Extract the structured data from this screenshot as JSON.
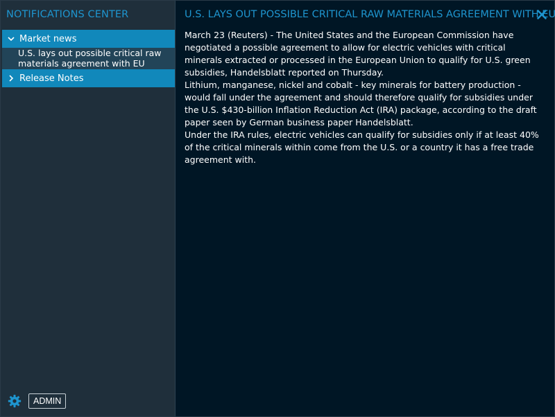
{
  "sidebar": {
    "title": "NOTIFICATIONS CENTER",
    "groups": [
      {
        "label": "Market news",
        "icon": "chevron-down-icon",
        "expanded": true,
        "items": [
          {
            "label": "U.S. lays out possible critical raw materials agreement with EU"
          }
        ]
      },
      {
        "label": "Release Notes",
        "icon": "chevron-right-icon",
        "expanded": false,
        "items": []
      }
    ],
    "footer": {
      "settings_icon": "gear-icon",
      "admin_label": "ADMIN"
    }
  },
  "article": {
    "title": "U.S. LAYS OUT POSSIBLE CRITICAL RAW MATERIALS AGREEMENT WITH EU",
    "paragraphs": [
      "March 23 (Reuters) - The United States and the European Commission have negotiated a possible agreement to allow for electric vehicles with critical minerals extracted or processed in the European Union to qualify for U.S. green subsidies, Handelsblatt reported on Thursday.",
      "Lithium, manganese, nickel and cobalt - key minerals for battery production - would fall under the agreement and should therefore qualify for subsidies under the U.S. $430-billion Inflation Reduction Act (IRA) package, according to the draft paper seen by German business paper Handelsblatt.",
      "Under the IRA rules, electric vehicles can qualify for subsidies only if at least 40% of the critical minerals within come from the U.S. or a country it has a free trade agreement with."
    ],
    "close_icon": "close-icon"
  },
  "colors": {
    "accent": "#1e95cf",
    "sidebar_bg": "#1f2f3b",
    "main_bg": "#001625",
    "selected_group_bg": "#1188bb",
    "selected_item_bg": "#224458",
    "text": "#ffffff"
  }
}
